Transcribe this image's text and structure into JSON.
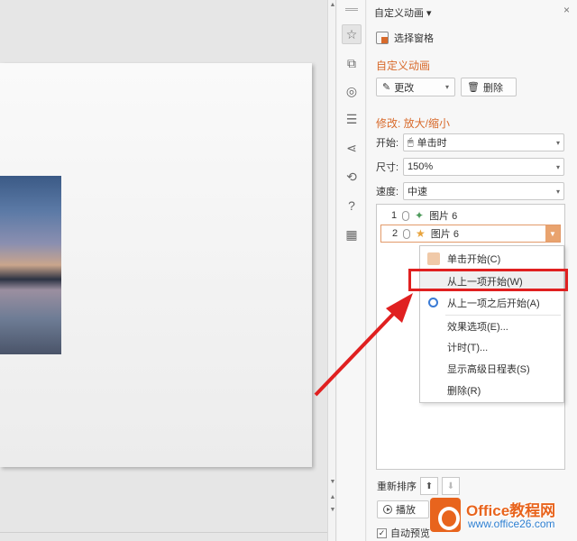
{
  "panel": {
    "title": "自定义动画 ▾",
    "close": "×",
    "selection_pane": "选择窗格",
    "section_title": "自定义动画",
    "change_label": "更改",
    "delete_label": "删除",
    "modify_title": "修改: 放大/缩小",
    "fields": {
      "start_label": "开始:",
      "start_value": "单击时",
      "size_label": "尺寸:",
      "size_value": "150%",
      "speed_label": "速度:",
      "speed_value": "中速"
    },
    "anim_items": [
      {
        "num": "1",
        "label": "图片 6"
      },
      {
        "num": "2",
        "label": "图片 6"
      }
    ],
    "reorder_label": "重新排序",
    "play_label": "播放",
    "autopreview_label": "自动预览"
  },
  "menu": {
    "items": [
      "单击开始(C)",
      "从上一项开始(W)",
      "从上一项之后开始(A)",
      "效果选项(E)...",
      "计时(T)...",
      "显示高级日程表(S)",
      "删除(R)"
    ]
  },
  "icons": {
    "iconbar": [
      "animation-icon",
      "transition-icon",
      "shape-icon",
      "properties-icon",
      "share-icon",
      "history-icon",
      "help-icon",
      "apps-icon"
    ]
  },
  "watermark": {
    "brand": "Office教程网",
    "url": "www.office26.com"
  }
}
